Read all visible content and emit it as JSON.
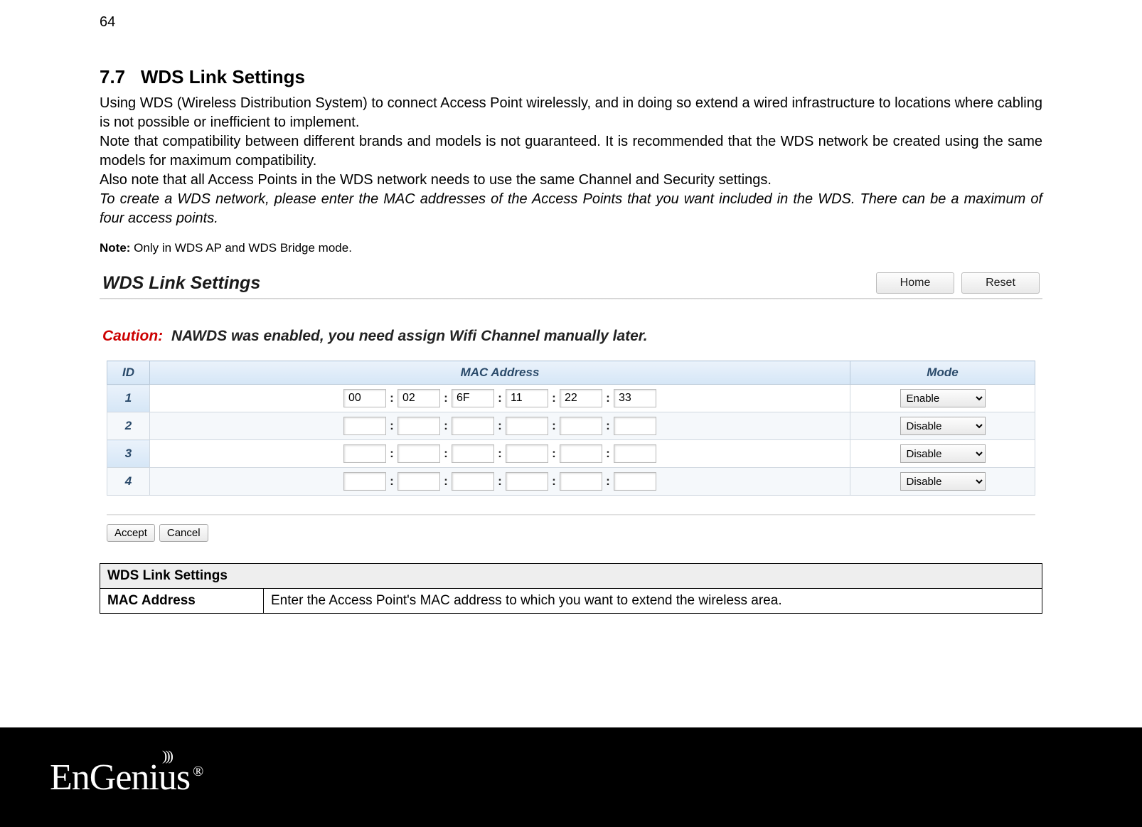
{
  "page_number": "64",
  "section_number": "7.7",
  "section_title": "WDS Link Settings",
  "para1": "Using WDS (Wireless Distribution System) to connect Access Point wirelessly, and in doing so extend a wired infrastructure to locations where cabling is not possible or inefficient to implement.",
  "para2": "Note that compatibility between different brands and models is not guaranteed. It is recommended that the WDS network be created using the same models for maximum compatibility.",
  "para3": "Also note that all Access Points in the WDS network needs to use the same Channel and Security settings.",
  "para4": "To create a WDS network, please enter the MAC addresses of the Access Points that you want included in the WDS. There can be a maximum of four access points.",
  "note_label": "Note:",
  "note_text": " Only in WDS AP and WDS Bridge mode.",
  "ui": {
    "title": "WDS Link Settings",
    "home_btn": "Home",
    "reset_btn": "Reset",
    "caution_label": "Caution:",
    "caution_text": "NAWDS was enabled, you need assign Wifi Channel manually later.",
    "col_id": "ID",
    "col_mac": "MAC Address",
    "col_mode": "Mode",
    "rows": [
      {
        "id": "1",
        "mac": [
          "00",
          "02",
          "6F",
          "11",
          "22",
          "33"
        ],
        "mode": "Enable"
      },
      {
        "id": "2",
        "mac": [
          "",
          "",
          "",
          "",
          "",
          ""
        ],
        "mode": "Disable"
      },
      {
        "id": "3",
        "mac": [
          "",
          "",
          "",
          "",
          "",
          ""
        ],
        "mode": "Disable"
      },
      {
        "id": "4",
        "mac": [
          "",
          "",
          "",
          "",
          "",
          ""
        ],
        "mode": "Disable"
      }
    ],
    "accept_btn": "Accept",
    "cancel_btn": "Cancel"
  },
  "def": {
    "header": "WDS Link Settings",
    "row1_label": "MAC Address",
    "row1_text": "Enter the Access Point's MAC address to which you want to extend the wireless area."
  },
  "brand": "EnGenius",
  "reg": "®"
}
